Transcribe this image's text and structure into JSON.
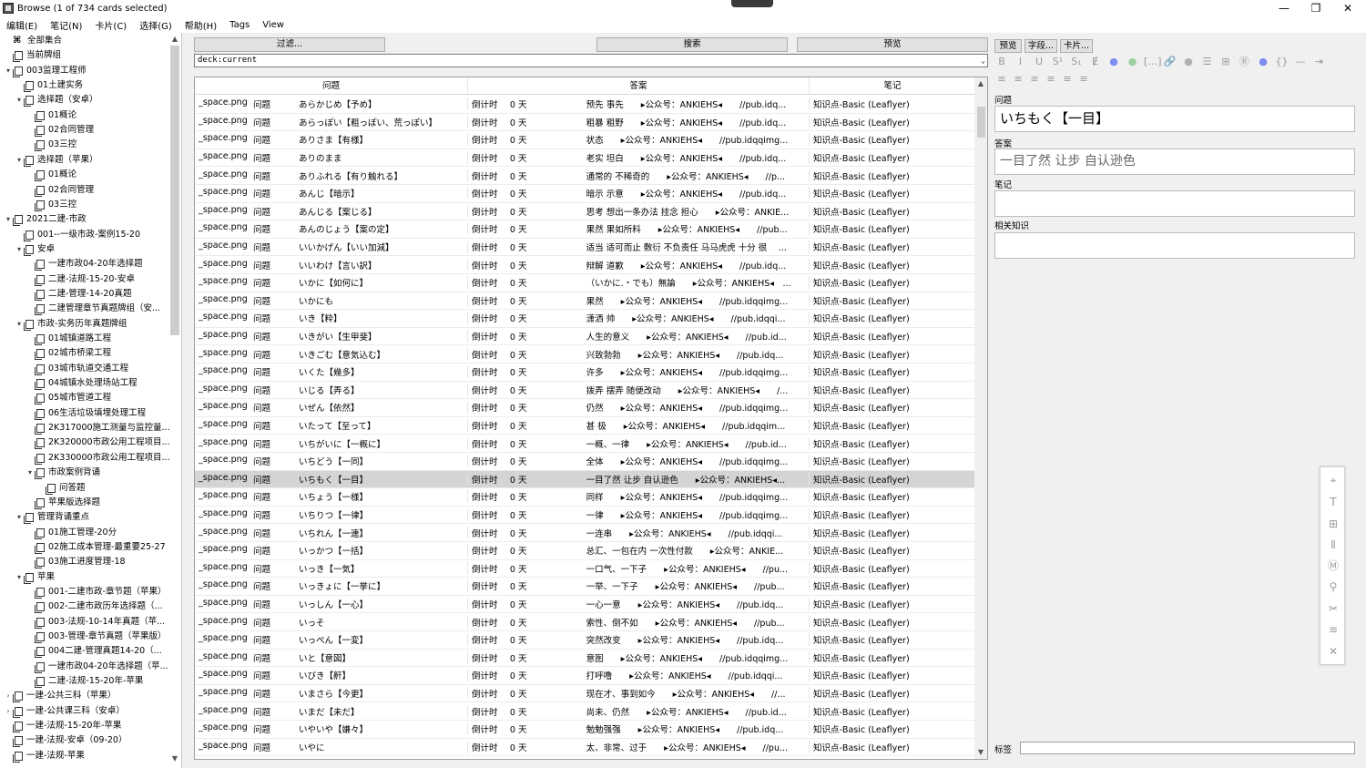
{
  "window": {
    "title": "Browse (1 of 734 cards selected)",
    "minimize": "—",
    "maximize": "❐",
    "close": "✕"
  },
  "menu": [
    "编辑(E)",
    "笔记(N)",
    "卡片(C)",
    "选择(G)",
    "帮助(H)",
    "Tags",
    "View"
  ],
  "sidebar": {
    "items": [
      {
        "label": "全部集合",
        "level": 0,
        "arrow": "",
        "kind": "all"
      },
      {
        "label": "当前牌组",
        "level": 0,
        "arrow": "",
        "kind": "deck"
      },
      {
        "label": "003监理工程师",
        "level": 0,
        "arrow": "⌄",
        "kind": "deck"
      },
      {
        "label": "01土建实务",
        "level": 1,
        "arrow": "",
        "kind": "deck"
      },
      {
        "label": "选择题（安卓）",
        "level": 1,
        "arrow": "⌄",
        "kind": "deck"
      },
      {
        "label": "01概论",
        "level": 2,
        "arrow": "",
        "kind": "deck"
      },
      {
        "label": "02合同管理",
        "level": 2,
        "arrow": "",
        "kind": "deck"
      },
      {
        "label": "03三控",
        "level": 2,
        "arrow": "",
        "kind": "deck"
      },
      {
        "label": "选择题（苹果）",
        "level": 1,
        "arrow": "⌄",
        "kind": "deck"
      },
      {
        "label": "01概论",
        "level": 2,
        "arrow": "",
        "kind": "deck"
      },
      {
        "label": "02合同管理",
        "level": 2,
        "arrow": "",
        "kind": "deck"
      },
      {
        "label": "03三控",
        "level": 2,
        "arrow": "",
        "kind": "deck"
      },
      {
        "label": "2021二建-市政",
        "level": 0,
        "arrow": "⌄",
        "kind": "deck"
      },
      {
        "label": "001--一级市政-案例15-20",
        "level": 1,
        "arrow": "",
        "kind": "deck"
      },
      {
        "label": "安卓",
        "level": 1,
        "arrow": "⌄",
        "kind": "deck"
      },
      {
        "label": "一建市政04-20年选择题",
        "level": 2,
        "arrow": "",
        "kind": "deck"
      },
      {
        "label": "二建-法规-15-20-安卓",
        "level": 2,
        "arrow": "",
        "kind": "deck"
      },
      {
        "label": "二建-管理-14-20真题",
        "level": 2,
        "arrow": "",
        "kind": "deck"
      },
      {
        "label": "二建管理章节真题牌组（安...",
        "level": 2,
        "arrow": "",
        "kind": "deck"
      },
      {
        "label": "市政-实务历年真题牌组",
        "level": 1,
        "arrow": "⌄",
        "kind": "deck"
      },
      {
        "label": "01城镇道路工程",
        "level": 2,
        "arrow": "",
        "kind": "deck"
      },
      {
        "label": "02城市桥梁工程",
        "level": 2,
        "arrow": "",
        "kind": "deck"
      },
      {
        "label": "03城市轨道交通工程",
        "level": 2,
        "arrow": "",
        "kind": "deck"
      },
      {
        "label": "04城镇水处理场站工程",
        "level": 2,
        "arrow": "",
        "kind": "deck"
      },
      {
        "label": "05城市管道工程",
        "level": 2,
        "arrow": "",
        "kind": "deck"
      },
      {
        "label": "06生活垃圾填埋处理工程",
        "level": 2,
        "arrow": "",
        "kind": "deck"
      },
      {
        "label": "2K317000施工测量与监控量...",
        "level": 2,
        "arrow": "",
        "kind": "deck"
      },
      {
        "label": "2K320000市政公用工程项目...",
        "level": 2,
        "arrow": "",
        "kind": "deck"
      },
      {
        "label": "2K330000市政公用工程项目...",
        "level": 2,
        "arrow": "",
        "kind": "deck"
      },
      {
        "label": "市政案例背诵",
        "level": 2,
        "arrow": "⌄",
        "kind": "deck"
      },
      {
        "label": "问答题",
        "level": 3,
        "arrow": "",
        "kind": "deck"
      },
      {
        "label": "苹果版选择题",
        "level": 2,
        "arrow": "",
        "kind": "deck"
      },
      {
        "label": "管理背诵重点",
        "level": 1,
        "arrow": "⌄",
        "kind": "deck"
      },
      {
        "label": "01施工管理-20分",
        "level": 2,
        "arrow": "",
        "kind": "deck"
      },
      {
        "label": "02施工成本管理-最重要25-27",
        "level": 2,
        "arrow": "",
        "kind": "deck"
      },
      {
        "label": "03施工进度管理-18",
        "level": 2,
        "arrow": "",
        "kind": "deck"
      },
      {
        "label": "苹果",
        "level": 1,
        "arrow": "⌄",
        "kind": "deck"
      },
      {
        "label": "001-二建市政-章节题（苹果）",
        "level": 2,
        "arrow": "",
        "kind": "deck"
      },
      {
        "label": "002-二建市政历年选择题（...",
        "level": 2,
        "arrow": "",
        "kind": "deck"
      },
      {
        "label": "003-法规-10-14年真题（苹...",
        "level": 2,
        "arrow": "",
        "kind": "deck"
      },
      {
        "label": "003-管理-章节真题（苹果版）",
        "level": 2,
        "arrow": "",
        "kind": "deck"
      },
      {
        "label": "004二建-管理真题14-20（...",
        "level": 2,
        "arrow": "",
        "kind": "deck"
      },
      {
        "label": "一建市政04-20年选择题（苹...",
        "level": 2,
        "arrow": "",
        "kind": "deck"
      },
      {
        "label": "二建-法规-15-20年-苹果",
        "level": 2,
        "arrow": "",
        "kind": "deck"
      },
      {
        "label": "一建-公共三科（苹果）",
        "level": 0,
        "arrow": "›",
        "kind": "deck"
      },
      {
        "label": "一建-公共课三科（安卓）",
        "level": 0,
        "arrow": "›",
        "kind": "deck"
      },
      {
        "label": "一建-法规-15-20年-苹果",
        "level": 0,
        "arrow": "",
        "kind": "deck"
      },
      {
        "label": "一建-法规-安卓（09-20）",
        "level": 0,
        "arrow": "",
        "kind": "deck"
      },
      {
        "label": "一建-法规-苹果",
        "level": 0,
        "arrow": "",
        "kind": "deck"
      }
    ]
  },
  "search": {
    "filter_button": "过滤...",
    "search_button": "搜索",
    "preview_button": "预览",
    "query": "deck:current"
  },
  "table": {
    "headers": [
      "问题",
      "答案",
      "笔记"
    ],
    "rows": [
      [
        "_space.png",
        "问题",
        "あらかじめ【予め】",
        "倒计时",
        "0 天",
        "预先 事先　　▸公众号：ANKIEHS◂　　//pub.idq...",
        "知识点-Basic (Leaflyer)"
      ],
      [
        "_space.png",
        "问题",
        "あらっぽい【粗っぽい、荒っぽい】",
        "倒计时",
        "0 天",
        "粗暴 粗野　　▸公众号：ANKIEHS◂　　//pub.idq...",
        "知识点-Basic (Leaflyer)"
      ],
      [
        "_space.png",
        "问题",
        "ありさま【有様】",
        "倒计时",
        "0 天",
        "状态　　▸公众号：ANKIEHS◂　　//pub.idqqimg...",
        "知识点-Basic (Leaflyer)"
      ],
      [
        "_space.png",
        "问题",
        "ありのまま",
        "倒计时",
        "0 天",
        "老实 坦白　　▸公众号：ANKIEHS◂　　//pub.idq...",
        "知识点-Basic (Leaflyer)"
      ],
      [
        "_space.png",
        "问题",
        "ありふれる【有り触れる】",
        "倒计时",
        "0 天",
        "通常的 不稀奇的　　▸公众号：ANKIEHS◂　　//p...",
        "知识点-Basic (Leaflyer)"
      ],
      [
        "_space.png",
        "问题",
        "あんじ【暗示】",
        "倒计时",
        "0 天",
        "暗示 示意　　▸公众号：ANKIEHS◂　　//pub.idq...",
        "知识点-Basic (Leaflyer)"
      ],
      [
        "_space.png",
        "问题",
        "あんじる【案じる】",
        "倒计时",
        "0 天",
        "思考 想出一条办法 挂念 担心　　▸公众号：ANKIE...",
        "知识点-Basic (Leaflyer)"
      ],
      [
        "_space.png",
        "问题",
        "あんのじょう【案の定】",
        "倒计时",
        "0 天",
        "果然 果如所料　　▸公众号：ANKIEHS◂　　//pub...",
        "知识点-Basic (Leaflyer)"
      ],
      [
        "_space.png",
        "问题",
        "いいかげん【いい加減】",
        "倒计时",
        "0 天",
        "适当 适可而止 敷衍 不负责任 马马虎虎 十分 很　 ...",
        "知识点-Basic (Leaflyer)"
      ],
      [
        "_space.png",
        "问题",
        "いいわけ【言い訳】",
        "倒计时",
        "0 天",
        "辩解 道歉　　▸公众号：ANKIEHS◂　　//pub.idq...",
        "知识点-Basic (Leaflyer)"
      ],
      [
        "_space.png",
        "问题",
        "いかに【如何に】",
        "倒计时",
        "0 天",
        "（いかに.・でも）無論　　▸公众号：ANKIEHS◂　...",
        "知识点-Basic (Leaflyer)"
      ],
      [
        "_space.png",
        "问题",
        "いかにも",
        "倒计时",
        "0 天",
        "果然　　▸公众号：ANKIEHS◂　　//pub.idqqimg...",
        "知识点-Basic (Leaflyer)"
      ],
      [
        "_space.png",
        "问题",
        "いき【粋】",
        "倒计时",
        "0 天",
        "潇洒 帅　　▸公众号：ANKIEHS◂　　//pub.idqqi...",
        "知识点-Basic (Leaflyer)"
      ],
      [
        "_space.png",
        "问题",
        "いきがい【生甲斐】",
        "倒计时",
        "0 天",
        "人生的意义　　▸公众号：ANKIEHS◂　　//pub.id...",
        "知识点-Basic (Leaflyer)"
      ],
      [
        "_space.png",
        "问题",
        "いきごむ【意気込む】",
        "倒计时",
        "0 天",
        "兴致勃勃　　▸公众号：ANKIEHS◂　　//pub.idq...",
        "知识点-Basic (Leaflyer)"
      ],
      [
        "_space.png",
        "问题",
        "いくた【幾多】",
        "倒计时",
        "0 天",
        "许多　　▸公众号：ANKIEHS◂　　//pub.idqqimg...",
        "知识点-Basic (Leaflyer)"
      ],
      [
        "_space.png",
        "问题",
        "いじる【弄る】",
        "倒计时",
        "0 天",
        "拨弄 摆弄 随便改动　　▸公众号：ANKIEHS◂　　/...",
        "知识点-Basic (Leaflyer)"
      ],
      [
        "_space.png",
        "问题",
        "いぜん【依然】",
        "倒计时",
        "0 天",
        "仍然　　▸公众号：ANKIEHS◂　　//pub.idqqimg...",
        "知识点-Basic (Leaflyer)"
      ],
      [
        "_space.png",
        "问题",
        "いたって【至って】",
        "倒计时",
        "0 天",
        "甚 极　　▸公众号：ANKIEHS◂　　//pub.idqqim...",
        "知识点-Basic (Leaflyer)"
      ],
      [
        "_space.png",
        "问题",
        "いちがいに【一概に】",
        "倒计时",
        "0 天",
        "一概、一律　　▸公众号：ANKIEHS◂　　//pub.id...",
        "知识点-Basic (Leaflyer)"
      ],
      [
        "_space.png",
        "问题",
        "いちどう【一同】",
        "倒计时",
        "0 天",
        "全体　　▸公众号：ANKIEHS◂　　//pub.idqqimg...",
        "知识点-Basic (Leaflyer)"
      ],
      [
        "_space.png",
        "问题",
        "いちもく【一目】",
        "倒计时",
        "0 天",
        "一目了然 让步 自认逊色　　▸公众号：ANKIEHS◂...",
        "知识点-Basic (Leaflyer)"
      ],
      [
        "_space.png",
        "问题",
        "いちょう【一様】",
        "倒计时",
        "0 天",
        "同样　　▸公众号：ANKIEHS◂　　//pub.idqqimg...",
        "知识点-Basic (Leaflyer)"
      ],
      [
        "_space.png",
        "问题",
        "いちりつ【一律】",
        "倒计时",
        "0 天",
        "一律　　▸公众号：ANKIEHS◂　　//pub.idqqimg...",
        "知识点-Basic (Leaflyer)"
      ],
      [
        "_space.png",
        "问题",
        "いちれん【一連】",
        "倒计时",
        "0 天",
        "一连串　　▸公众号：ANKIEHS◂　　//pub.idqqi...",
        "知识点-Basic (Leaflyer)"
      ],
      [
        "_space.png",
        "问题",
        "いっかつ【一括】",
        "倒计时",
        "0 天",
        "总汇、一包在内 一次性付款　　▸公众号：ANKIE...",
        "知识点-Basic (Leaflyer)"
      ],
      [
        "_space.png",
        "问题",
        "いっき【一気】",
        "倒计时",
        "0 天",
        "一口气、一下子　　▸公众号：ANKIEHS◂　　//pu...",
        "知识点-Basic (Leaflyer)"
      ],
      [
        "_space.png",
        "问题",
        "いっきょに【一挙に】",
        "倒计时",
        "0 天",
        "一举、一下子　　▸公众号：ANKIEHS◂　　//pub...",
        "知识点-Basic (Leaflyer)"
      ],
      [
        "_space.png",
        "问题",
        "いっしん【一心】",
        "倒计时",
        "0 天",
        "一心一意　　▸公众号：ANKIEHS◂　　//pub.idq...",
        "知识点-Basic (Leaflyer)"
      ],
      [
        "_space.png",
        "问题",
        "いっそ",
        "倒计时",
        "0 天",
        "索性、倒不如　　▸公众号：ANKIEHS◂　　//pub...",
        "知识点-Basic (Leaflyer)"
      ],
      [
        "_space.png",
        "问题",
        "いっぺん【一変】",
        "倒计时",
        "0 天",
        "突然改变　　▸公众号：ANKIEHS◂　　//pub.idq...",
        "知识点-Basic (Leaflyer)"
      ],
      [
        "_space.png",
        "问题",
        "いと【意図】",
        "倒计时",
        "0 天",
        "意图　　▸公众号：ANKIEHS◂　　//pub.idqqimg...",
        "知识点-Basic (Leaflyer)"
      ],
      [
        "_space.png",
        "问题",
        "いびき【鼾】",
        "倒计时",
        "0 天",
        "打呼噜　　▸公众号：ANKIEHS◂　　//pub.idqqi...",
        "知识点-Basic (Leaflyer)"
      ],
      [
        "_space.png",
        "问题",
        "いまさら【今更】",
        "倒计时",
        "0 天",
        "现在才、事到如今　　▸公众号：ANKIEHS◂　　//...",
        "知识点-Basic (Leaflyer)"
      ],
      [
        "_space.png",
        "问题",
        "いまだ【未だ】",
        "倒计时",
        "0 天",
        "尚未、仍然　　▸公众号：ANKIEHS◂　　//pub.id...",
        "知识点-Basic (Leaflyer)"
      ],
      [
        "_space.png",
        "问题",
        "いやいや【嫌々】",
        "倒计时",
        "0 天",
        "勉勉强强　　▸公众号：ANKIEHS◂　　//pub.idq...",
        "知识点-Basic (Leaflyer)"
      ],
      [
        "_space.png",
        "问题",
        "いやに",
        "倒计时",
        "0 天",
        "太、非常、过于　　▸公众号：ANKIEHS◂　　//pu...",
        "知识点-Basic (Leaflyer)"
      ]
    ],
    "selected_index": 21
  },
  "editor": {
    "buttons": [
      "预览",
      "字段...",
      "卡片..."
    ],
    "fields": [
      {
        "label": "问题",
        "value": "いちもく【一目】"
      },
      {
        "label": "答案",
        "value": "一目了然 让步 自认逊色"
      },
      {
        "label": "笔记",
        "value": ""
      },
      {
        "label": "相关知识",
        "value": ""
      }
    ],
    "tags_label": "标签",
    "tags_value": ""
  },
  "toolbar_icons": [
    "bold-icon",
    "italic-icon",
    "underline-icon",
    "superscript-icon",
    "subscript-icon",
    "clear-format-icon",
    "text-color-icon",
    "highlight-icon",
    "cloze-icon",
    "attach-icon",
    "record-icon",
    "list-icon",
    "table-icon",
    "ruby-icon",
    "color-icon",
    "code-icon",
    "hr-icon",
    "indent-icon"
  ],
  "float_tools": [
    "crosshair-icon",
    "text-tool-icon",
    "grid-icon",
    "columns-icon",
    "markdown-icon",
    "zoom-icon",
    "scissors-icon",
    "menu-icon",
    "close-icon"
  ]
}
